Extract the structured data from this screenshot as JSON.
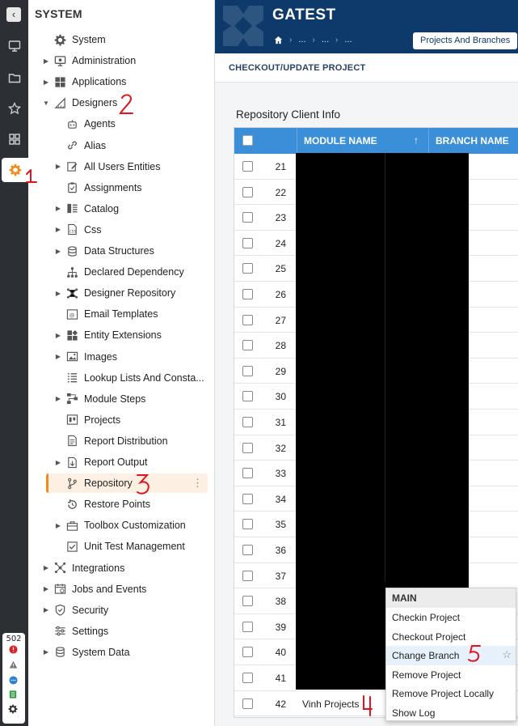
{
  "sidebar": {
    "title": "SYSTEM",
    "items": [
      {
        "label": "System",
        "icon": "gear-icon",
        "caret": false,
        "level": 0
      },
      {
        "label": "Administration",
        "icon": "monitor-icon",
        "caret": true,
        "level": 0
      },
      {
        "label": "Applications",
        "icon": "grid-icon",
        "caret": true,
        "level": 0
      },
      {
        "label": "Designers",
        "icon": "ruler-icon",
        "caret": true,
        "expanded": true,
        "level": 0
      },
      {
        "label": "Agents",
        "icon": "robot-icon",
        "caret": false,
        "level": 1
      },
      {
        "label": "Alias",
        "icon": "link-icon",
        "caret": false,
        "level": 1
      },
      {
        "label": "All Users Entities",
        "icon": "edit-icon",
        "caret": true,
        "level": 1
      },
      {
        "label": "Assignments",
        "icon": "clipboard-icon",
        "caret": false,
        "level": 1
      },
      {
        "label": "Catalog",
        "icon": "catalog-icon",
        "caret": true,
        "level": 1
      },
      {
        "label": "Css",
        "icon": "css-icon",
        "caret": true,
        "level": 1
      },
      {
        "label": "Data Structures",
        "icon": "database-icon",
        "caret": true,
        "level": 1
      },
      {
        "label": "Declared Dependency",
        "icon": "hierarchy-icon",
        "caret": false,
        "level": 1
      },
      {
        "label": "Designer Repository",
        "icon": "network-icon",
        "caret": true,
        "level": 1
      },
      {
        "label": "Email Templates",
        "icon": "email-icon",
        "caret": false,
        "level": 1
      },
      {
        "label": "Entity Extensions",
        "icon": "blocks-icon",
        "caret": true,
        "level": 1
      },
      {
        "label": "Images",
        "icon": "image-icon",
        "caret": true,
        "level": 1
      },
      {
        "label": "Lookup Lists And Consta...",
        "icon": "list-icon",
        "caret": false,
        "level": 1
      },
      {
        "label": "Module Steps",
        "icon": "steps-icon",
        "caret": true,
        "level": 1
      },
      {
        "label": "Projects",
        "icon": "projects-icon",
        "caret": false,
        "level": 1
      },
      {
        "label": "Report Distribution",
        "icon": "report-icon",
        "caret": false,
        "level": 1
      },
      {
        "label": "Report Output",
        "icon": "report-output-icon",
        "caret": true,
        "level": 1
      },
      {
        "label": "Repository",
        "icon": "branch-icon",
        "caret": false,
        "level": 1,
        "selected": true
      },
      {
        "label": "Restore Points",
        "icon": "restore-icon",
        "caret": false,
        "level": 1
      },
      {
        "label": "Toolbox Customization",
        "icon": "toolbox-icon",
        "caret": true,
        "level": 1
      },
      {
        "label": "Unit Test Management",
        "icon": "test-icon",
        "caret": false,
        "level": 1
      },
      {
        "label": "Integrations",
        "icon": "integrations-icon",
        "caret": true,
        "level": 0
      },
      {
        "label": "Jobs and Events",
        "icon": "calendar-icon",
        "caret": true,
        "level": 0
      },
      {
        "label": "Security",
        "icon": "shield-icon",
        "caret": true,
        "level": 0
      },
      {
        "label": "Settings",
        "icon": "sliders-icon",
        "caret": false,
        "level": 0
      },
      {
        "label": "System Data",
        "icon": "database-icon",
        "caret": true,
        "level": 0
      }
    ]
  },
  "rail": {
    "icons": [
      "monitor-icon",
      "folder-icon",
      "star-icon",
      "grid-icon",
      "gear-icon"
    ],
    "active": "gear-icon",
    "status_count": "502"
  },
  "header": {
    "app_title": "GATEST",
    "breadcrumbs": [
      "...",
      "...",
      "..."
    ],
    "projects_button": "Projects And Branches"
  },
  "subheader": {
    "title": "CHECKOUT/UPDATE PROJECT"
  },
  "main": {
    "section_title": "Repository Client Info",
    "columns": [
      "MODULE NAME",
      "BRANCH NAME"
    ],
    "rows": [
      {
        "num": "21",
        "module": ""
      },
      {
        "num": "22",
        "module": ""
      },
      {
        "num": "23",
        "module": ""
      },
      {
        "num": "24",
        "module": ""
      },
      {
        "num": "25",
        "module": ""
      },
      {
        "num": "26",
        "module": ""
      },
      {
        "num": "27",
        "module": ""
      },
      {
        "num": "28",
        "module": ""
      },
      {
        "num": "29",
        "module": ""
      },
      {
        "num": "30",
        "module": ""
      },
      {
        "num": "31",
        "module": ""
      },
      {
        "num": "32",
        "module": ""
      },
      {
        "num": "33",
        "module": ""
      },
      {
        "num": "34",
        "module": ""
      },
      {
        "num": "35",
        "module": ""
      },
      {
        "num": "36",
        "module": ""
      },
      {
        "num": "37",
        "module": ""
      },
      {
        "num": "38",
        "module": ""
      },
      {
        "num": "39",
        "module": ""
      },
      {
        "num": "40",
        "module": ""
      },
      {
        "num": "41",
        "module": ""
      },
      {
        "num": "42",
        "module": "Vinh Projects"
      }
    ]
  },
  "context_menu": {
    "header": "MAIN",
    "items": [
      "Checkin Project",
      "Checkout Project",
      "Change Branch",
      "Remove Project",
      "Remove Project Locally",
      "Show Log"
    ],
    "highlighted": "Change Branch"
  },
  "annotations": [
    "1",
    "2",
    "3",
    "4",
    "5"
  ],
  "colors": {
    "rail_bg": "#2c2f34",
    "header_bg": "#0e3a6b",
    "grid_header": "#3b8ed8",
    "accent_orange": "#f28b1b",
    "annotation_red": "#e0141e"
  }
}
